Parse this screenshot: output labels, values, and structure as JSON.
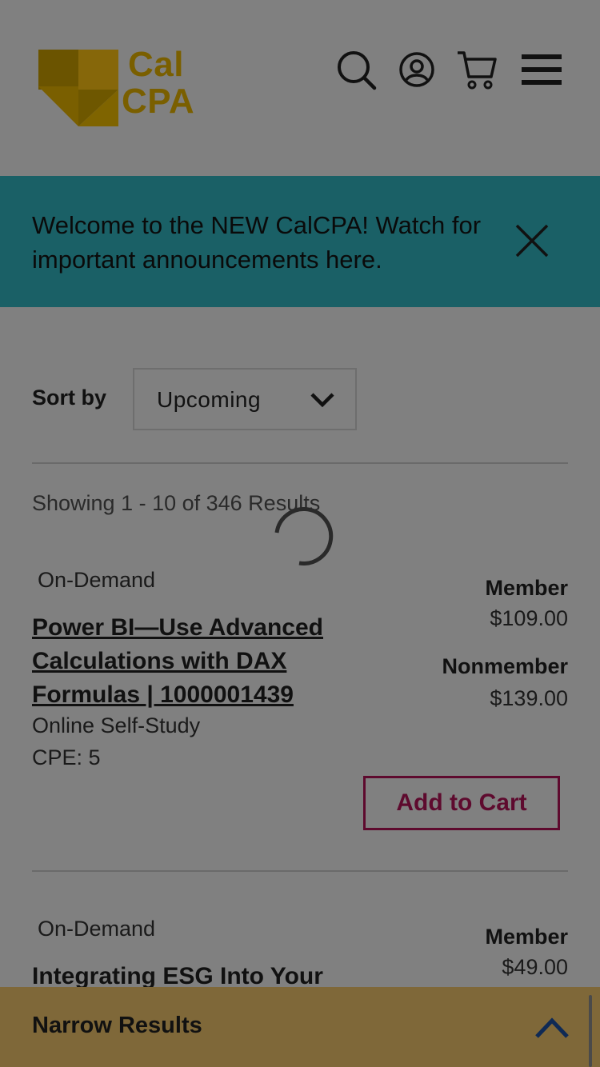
{
  "header": {
    "logo_line1": "Cal",
    "logo_line2": "CPA",
    "icons": [
      "search-icon",
      "user-account-icon",
      "cart-icon",
      "menu-icon"
    ]
  },
  "banner": {
    "text": "Welcome to the NEW CalCPA! Watch for important announcements here.",
    "close_icon": "close-icon"
  },
  "sort": {
    "label": "Sort by",
    "selected": "Upcoming"
  },
  "results": {
    "showing": "Showing 1 - 10 of 346 Results"
  },
  "courses": [
    {
      "tag": "On-Demand",
      "title": "Power BI—Use Advanced Calculations with DAX Formulas | 1000001439",
      "format": "Online Self-Study",
      "cpe": "CPE: 5",
      "member_label": "Member",
      "member_price": "$109.00",
      "nonmember_label": "Nonmember",
      "nonmember_price": "$139.00",
      "cta": "Add to Cart"
    },
    {
      "tag": "On-Demand",
      "title": "Integrating ESG Into Your",
      "member_label": "Member",
      "member_price": "$49.00"
    }
  ],
  "narrow": {
    "label": "Narrow Results"
  },
  "colors": {
    "overlay_bg": "#808080",
    "banner": "#1a6066",
    "logo": "#7a5f00",
    "cta": "#5e0a2e",
    "narrow_bar": "#7f6839",
    "chevron": "#0f2a55"
  }
}
